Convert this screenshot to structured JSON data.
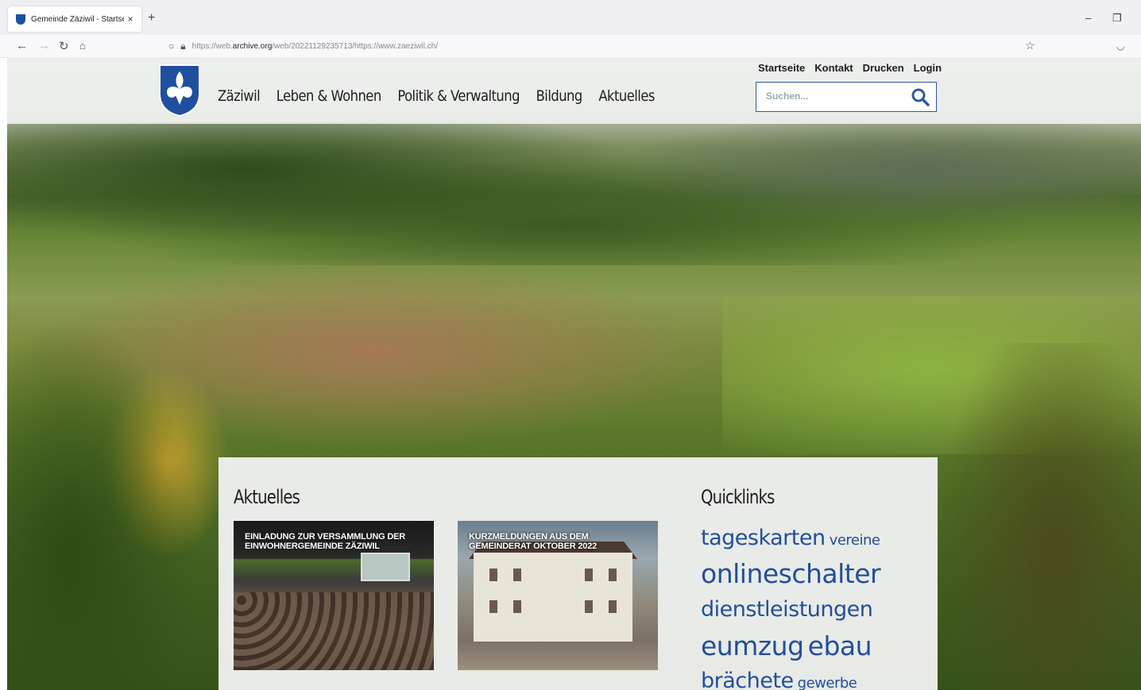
{
  "browser": {
    "tab_title": "Gemeinde Zäziwil - Startseite",
    "tab_close": "×",
    "new_tab": "+",
    "url_prefix": "https://web.",
    "url_domain": "archive.org",
    "url_rest": "/web/20221129235713/https://www.zaeziwil.ch/",
    "minimize": "–",
    "restore": "❐"
  },
  "site": {
    "main_nav": [
      "Zäziwil",
      "Leben & Wohnen",
      "Politik & Verwaltung",
      "Bildung",
      "Aktuelles"
    ],
    "top_links": [
      "Startseite",
      "Kontakt",
      "Drucken",
      "Login"
    ],
    "search_placeholder": "Suchen..."
  },
  "aktuelles": {
    "title": "Aktuelles",
    "cards": [
      {
        "caption": "EINLADUNG ZUR VERSAMMLUNG DER EINWOHNERGEMEINDE ZÄZIWIL"
      },
      {
        "caption": "KURZMELDUNGEN AUS DEM GEMEINDERAT OKTOBER 2022"
      }
    ]
  },
  "quicklinks": {
    "title": "Quicklinks",
    "tags": [
      "tageskarten",
      "vereine",
      "onlineschalter",
      "dienstleistungen",
      "eumzug",
      "ebau",
      "brächete",
      "gewerbe"
    ]
  },
  "colors": {
    "link_blue": "#234f9a",
    "search_border": "#2c5aa0"
  }
}
